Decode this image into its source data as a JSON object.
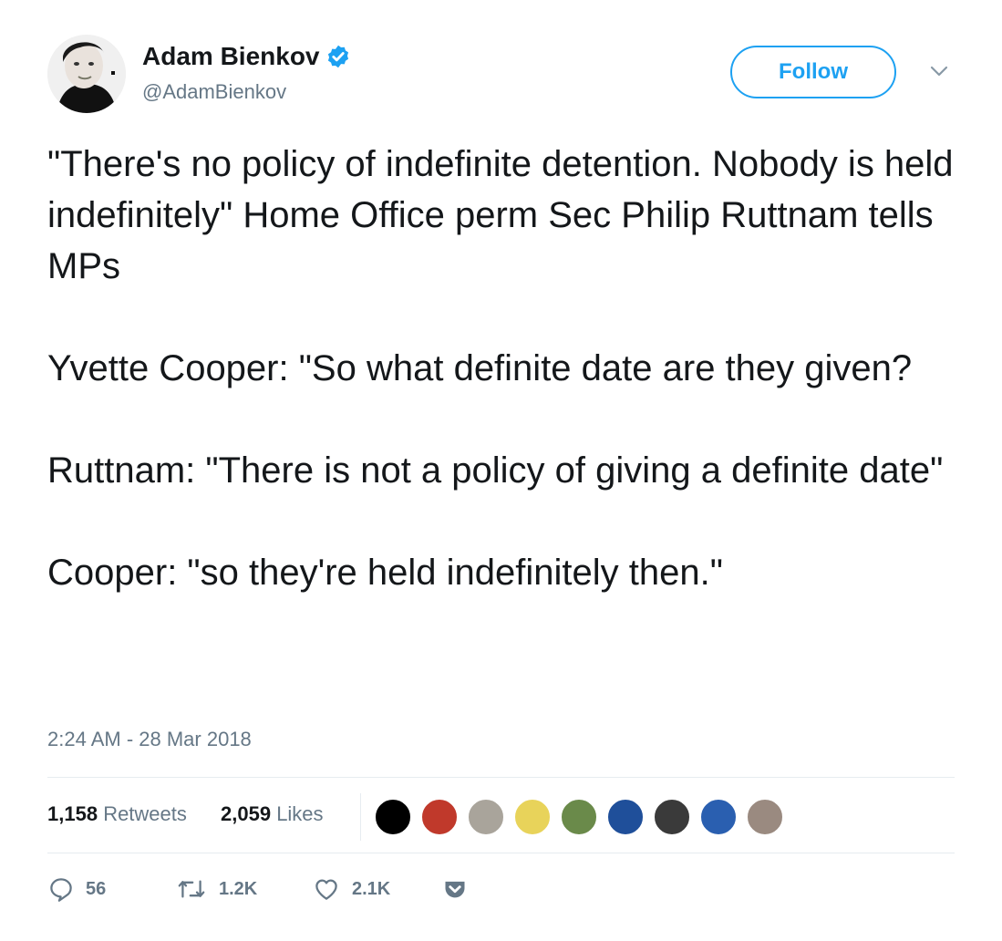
{
  "author": {
    "display_name": "Adam Bienkov",
    "handle": "@AdamBienkov",
    "verified": true,
    "avatar_icon": "user-avatar"
  },
  "header": {
    "follow_label": "Follow",
    "caret_icon": "chevron-down-icon"
  },
  "tweet": {
    "paragraphs": [
      "\"There's no policy of indefinite detention. Nobody is held indefinitely\" Home Office perm Sec Philip Ruttnam tells MPs",
      "Yvette Cooper: \"So what definite date are they given?",
      "Ruttnam: \"There is not a policy of giving a definite date\"",
      "Cooper: \"so they're held indefinitely then.\""
    ],
    "timestamp": "2:24 AM - 28 Mar 2018"
  },
  "stats": {
    "retweets_count": "1,158",
    "retweets_label": "Retweets",
    "likes_count": "2,059",
    "likes_label": "Likes",
    "likers": [
      "#000000",
      "#c0392b",
      "#a9a49b",
      "#e8d35a",
      "#6a8a4a",
      "#1f4f9a",
      "#3a3a3a",
      "#2a5fb0",
      "#9a8a80"
    ]
  },
  "actions": {
    "reply_count": "56",
    "retweet_count": "1.2K",
    "like_count": "2.1K",
    "colors": {
      "icon": "#657786",
      "accent": "#1da1f2"
    }
  }
}
